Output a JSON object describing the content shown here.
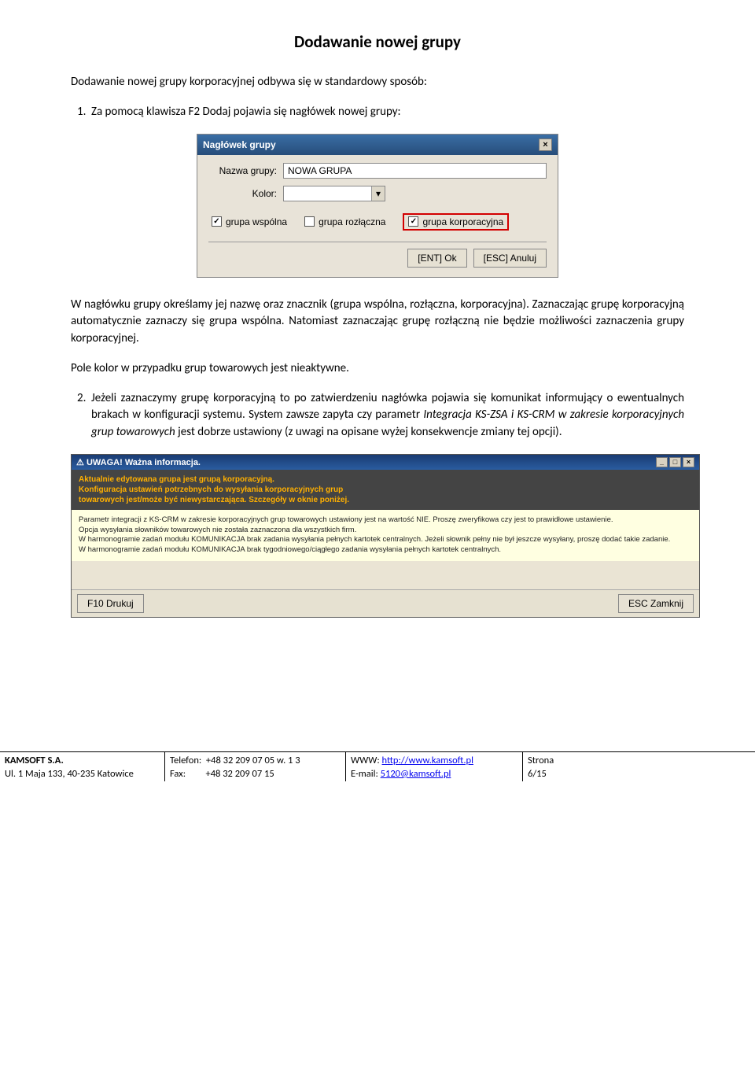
{
  "heading": "Dodawanie nowej grupy",
  "intro": "Dodawanie nowej grupy korporacyjnej odbywa się w standardowy sposób:",
  "item1": {
    "marker": "1.",
    "text": "Za pomocą klawisza F2 Dodaj pojawia się nagłówek nowej grupy:"
  },
  "dialog1": {
    "title": "Nagłówek grupy",
    "close": "×",
    "labels": {
      "nazwa": "Nazwa grupy:",
      "kolor": "Kolor:"
    },
    "values": {
      "nazwa": "NOWA GRUPA"
    },
    "chk": {
      "wspolna": "grupa wspólna",
      "rozlaczna": "grupa rozłączna",
      "korporacyjna": "grupa korporacyjna"
    },
    "chk_state": {
      "wspolna": "✓",
      "rozlaczna": "",
      "korporacyjna": "✓"
    },
    "dropdown": "▾",
    "buttons": {
      "ok": "[ENT] Ok",
      "cancel": "[ESC] Anuluj"
    }
  },
  "para2_a": "W nagłówku grupy określamy jej nazwę oraz znacznik (grupa wspólna, rozłączna, korporacyjna). Zaznaczając grupę korporacyjną automatycznie zaznaczy się grupa wspólna. Natomiast zaznaczając grupę rozłączną nie będzie możliwości zaznaczenia grupy korporacyjnej.",
  "para2_b": "Pole kolor w przypadku grup towarowych jest nieaktywne.",
  "item2": {
    "marker": "2.",
    "text_a": "Jeżeli zaznaczymy grupę korporacyjną to po zatwierdzeniu nagłówka pojawia się komunikat informujący o ewentualnych brakach w konfiguracji systemu. System zawsze zapyta czy parametr ",
    "text_i1": "Integracja KS-ZSA i KS-CRM w zakresie korporacyjnych grup towarowych",
    "text_b": " jest dobrze ustawiony (z uwagi na opisane wyżej konsekwencje zmiany tej opcji)."
  },
  "dialog2": {
    "title_icon": "⚠",
    "title": "UWAGA! Ważna informacja.",
    "warn_l1": "Aktualnie edytowana grupa jest grupą korporacyjną.",
    "warn_l2": "Konfiguracja ustawień potrzebnych do wysyłania korporacyjnych grup",
    "warn_l3": "towarowych jest/może być niewystarczająca. Szczegóły w oknie poniżej.",
    "body_l1": "Parametr integracji z KS-CRM w zakresie korporacyjnych grup towarowych ustawiony jest na wartość NIE. Proszę zweryfikowa czy jest to prawidłowe ustawienie.",
    "body_l2": "Opcja wysyłania słowników towarowych nie została zaznaczona dla wszystkich firm.",
    "body_l3": "W harmonogramie zadań modułu KOMUNIKACJA brak zadania wysyłania pełnych kartotek centralnych. Jeżeli słownik pełny nie był jeszcze wysyłany, proszę dodać takie zadanie.",
    "body_l4": "W harmonogramie zadań modułu KOMUNIKACJA brak tygodniowego/ciągłego zadania wysyłania pełnych kartotek centralnych.",
    "btn_print": "F10 Drukuj",
    "btn_close": "ESC Zamknij",
    "winctrls": {
      "min": "_",
      "max": "□",
      "close": "×"
    }
  },
  "footer": {
    "c1_l1": "KAMSOFT S.A.",
    "c1_l2": "Ul. 1 Maja 133, 40-235 Katowice",
    "c2_l1a": "Telefon:",
    "c2_l1b": "+48 32 209 07 05 w. 1 3",
    "c2_l2a": "Fax:",
    "c2_l2b": "+48 32 209 07 15",
    "c3_l1a": "WWW: ",
    "c3_l1b": "http://www.kamsoft.pl",
    "c3_l2a": "E-mail: ",
    "c3_l2b": "5120@kamsoft.pl",
    "c4_l1": "Strona",
    "c4_l2": "6/15"
  }
}
